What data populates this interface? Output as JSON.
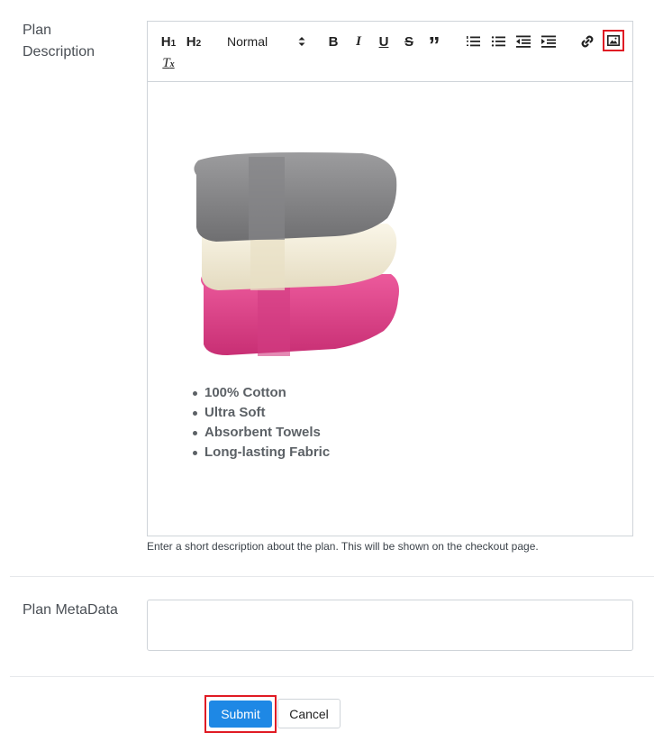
{
  "plan_description": {
    "label_line1": "Plan",
    "label_line2": "Description"
  },
  "toolbar": {
    "h1": "H",
    "h1_sub": "1",
    "h2": "H",
    "h2_sub": "2",
    "header_select": "Normal",
    "bold": "B",
    "italic": "I",
    "underline": "U",
    "strike": "S",
    "blockquote": "”",
    "clean": "T",
    "clean_sub": "x",
    "icons": [
      "heading-1-icon",
      "heading-2-icon",
      "bold-icon",
      "italic-icon",
      "underline-icon",
      "strikethrough-icon",
      "blockquote-icon",
      "ordered-list-icon",
      "bullet-list-icon",
      "outdent-icon",
      "indent-icon",
      "link-icon",
      "image-icon",
      "clear-format-icon"
    ]
  },
  "editor": {
    "image_desc": "stack of grey, cream and pink towels",
    "bullets": [
      "100% Cotton",
      "Ultra Soft",
      "Absorbent Towels",
      "Long-lasting Fabric"
    ]
  },
  "helper_text": "Enter a short description about the plan. This will be shown on the checkout page.",
  "plan_metadata": {
    "label": "Plan MetaData",
    "value": ""
  },
  "actions": {
    "submit": "Submit",
    "cancel": "Cancel"
  },
  "colors": {
    "accent": "#1e88e5",
    "highlight": "#e01b24",
    "towel_grey": "#8a8a8c",
    "towel_cream": "#f3ecd7",
    "towel_pink": "#e2468c"
  }
}
